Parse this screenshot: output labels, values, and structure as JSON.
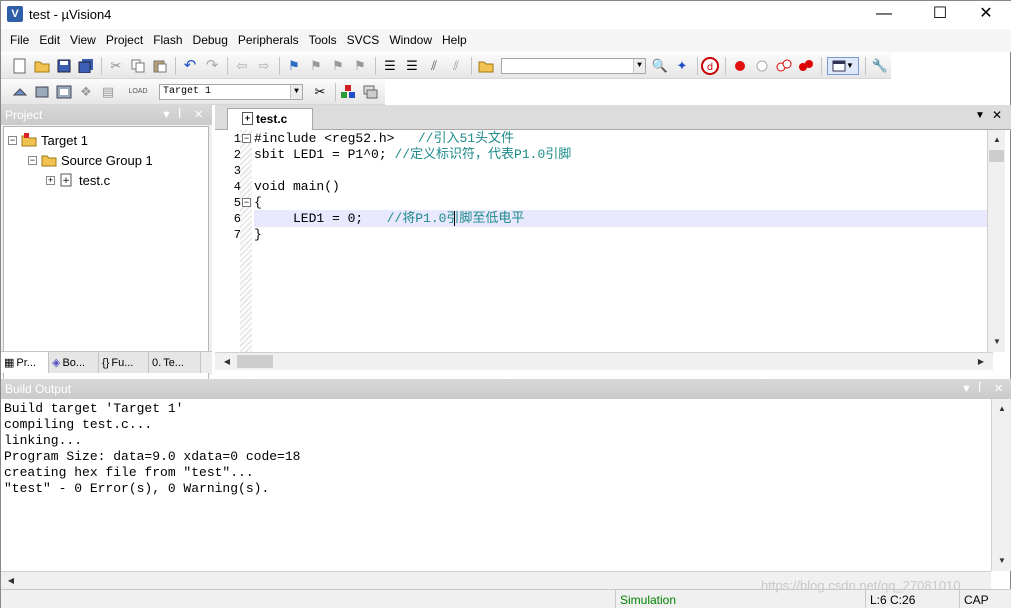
{
  "window": {
    "title": "test - µVision4",
    "app_icon": "uvision-icon",
    "controls": {
      "minimize": "—",
      "maximize": "☐",
      "close": "✕"
    }
  },
  "menu": [
    "File",
    "Edit",
    "View",
    "Project",
    "Flash",
    "Debug",
    "Peripherals",
    "Tools",
    "SVCS",
    "Window",
    "Help"
  ],
  "toolbar2": {
    "target_select": "Target 1"
  },
  "project_panel": {
    "title": "Project",
    "tree": {
      "target": "Target 1",
      "group": "Source Group 1",
      "file": "test.c"
    },
    "tabs": [
      "Pr...",
      "Bo...",
      "Fu...",
      "Te..."
    ]
  },
  "editor": {
    "tab_label": "test.c",
    "lines": [
      {
        "n": "1",
        "code": "#include <reg52.h>",
        "comment": "   //引入51头文件"
      },
      {
        "n": "2",
        "code": "sbit LED1 = P1^0; ",
        "comment": "//定义标识符，代表P1.0引脚"
      },
      {
        "n": "3",
        "code": "",
        "comment": ""
      },
      {
        "n": "4",
        "code": "void main()",
        "comment": ""
      },
      {
        "n": "5",
        "code": "{",
        "comment": ""
      },
      {
        "n": "6",
        "code": "     LED1 = 0;   ",
        "comment": "//将P1.0引脚至低电平"
      },
      {
        "n": "7",
        "code": "}",
        "comment": ""
      }
    ]
  },
  "build_output": {
    "title": "Build Output",
    "lines": [
      "Build target 'Target 1'",
      "compiling test.c...",
      "linking...",
      "Program Size: data=9.0 xdata=0 code=18",
      "creating hex file from \"test\"...",
      "\"test\" - 0 Error(s), 0 Warning(s)."
    ]
  },
  "status": {
    "mode": "Simulation",
    "position": "L:6 C:26",
    "caps": "CAP"
  },
  "watermark": "https://blog.csdn.net/qq_27081010",
  "colors": {
    "comment": "#1e8a8a",
    "current_line": "#e8e8ff",
    "simulation": "#008000"
  }
}
